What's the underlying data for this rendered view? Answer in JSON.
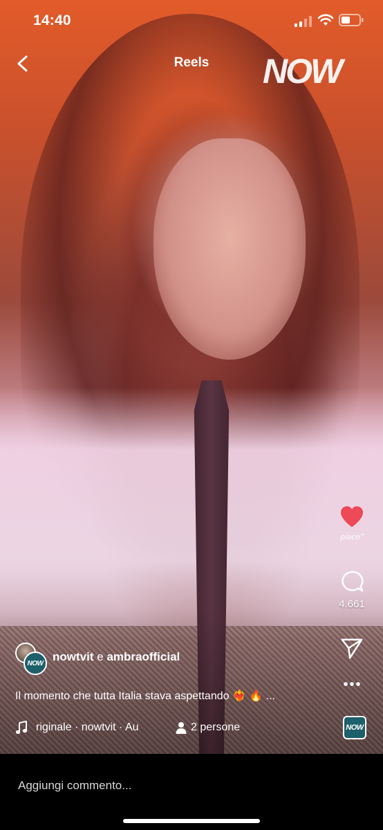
{
  "status_bar": {
    "time": "14:40"
  },
  "header": {
    "title": "Reels",
    "brand": "NOW"
  },
  "actions": {
    "likes_label": "piace\"",
    "comments_count": "4.661"
  },
  "author": {
    "name_primary": "nowtvit",
    "connector": "e",
    "name_secondary": "ambraofficial",
    "avatar_badge": "NOW"
  },
  "caption": {
    "text": "Il momento che tutta Italia stava aspettando ❤️‍🔥 🔥 ..."
  },
  "music": {
    "text": "riginale · nowtvit · Au",
    "people": "2 persone",
    "thumb_label": "NOW"
  },
  "comment": {
    "placeholder": "Aggiungi commento..."
  },
  "colors": {
    "like": "#ed4956",
    "background": "#000000"
  }
}
